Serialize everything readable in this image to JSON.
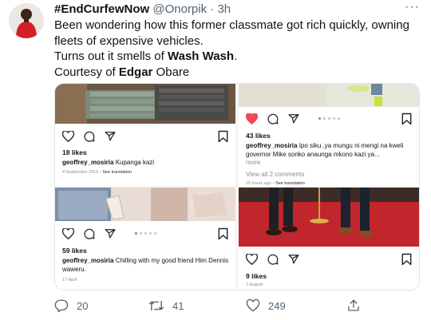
{
  "tweet": {
    "display_name": "#EndCurfewNow",
    "handle": "@Onorpik",
    "separator": "·",
    "time": "3h",
    "more_glyph": "···",
    "lines": [
      "Been wondering how this former classmate got rich quickly, owning fleets of expensive vehicles.",
      "Turns out it smells of ",
      "Courtesy of "
    ],
    "bold_1": "Wash Wash",
    "end_1": ".",
    "bold_2": "Edgar",
    "end_2": " Obare"
  },
  "posts": [
    {
      "likes": "18 likes",
      "user": "geoffrey_mosiria",
      "caption": " Kupanga kazi",
      "date": "4 September 2016 • ",
      "see_translation": "See translation"
    },
    {
      "liked": true,
      "likes": "43 likes",
      "user": "geoffrey_mosiria",
      "caption": " Ipo siku ,ya mungu ni mengi na kweli governor Mike sonko anaunga mkono kazi ya...",
      "more": "more",
      "comments": "View all 2 comments",
      "date": "15 hours ago • ",
      "see_translation": "See translation"
    },
    {
      "likes": "59 likes",
      "user": "geoffrey_mosiria",
      "caption": " Chilling with my good friend Him Dennis waweru.",
      "date": "17 April"
    },
    {
      "likes": "9 likes",
      "date": "7 August"
    }
  ],
  "actions": {
    "reply_count": "20",
    "retweet_count": "41",
    "like_count": "249"
  },
  "colors": {
    "text": "#0f1419",
    "muted": "#536471",
    "liked_heart": "#ed4956",
    "carousel_dot_active": "#3897f0"
  }
}
